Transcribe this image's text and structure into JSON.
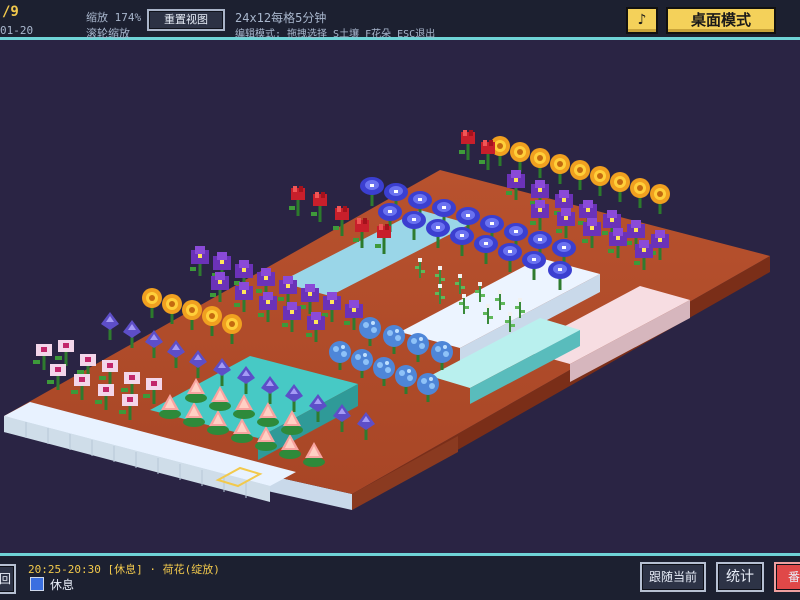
{
  "topbar": {
    "counter": "/9",
    "date": "01-20",
    "zoom_label": "缩放 174%",
    "scroll_label": "滚轮缩放",
    "reset_view": "重置视图",
    "grid_info": "24x12每格5分钟",
    "edit_hint": "编辑模式: 拖拽选择 S土壤 F花朵 ESC退出",
    "music_icon": "♪",
    "desktop_mode": "桌面模式"
  },
  "bottombar": {
    "back_button": "回",
    "time_range": "20:25-20:30",
    "status": "[休息] · 荷花(绽放)",
    "legend_label": "休息",
    "legend_color": "#3b6fe0",
    "follow_now": "跟随当前",
    "stats": "统计",
    "red_button": "番",
    "red_color": "#e04848"
  },
  "colors": {
    "accent": "#6fd3d6",
    "background": "#2a2444",
    "soil": "#b04a2a",
    "tile": "#e7f3ff"
  }
}
